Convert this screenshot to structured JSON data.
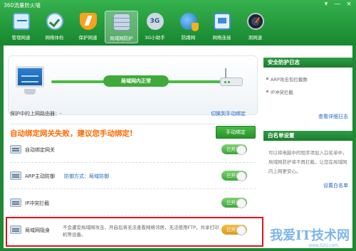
{
  "app": {
    "title": "360流量防火墙"
  },
  "window_controls": [
    "▾",
    "—",
    "×"
  ],
  "toolbar": [
    {
      "label": "管理网速",
      "icon": "speed-monitor-icon",
      "active": false
    },
    {
      "label": "网络体检",
      "icon": "health-check-icon",
      "active": false
    },
    {
      "label": "保护网速",
      "icon": "shield-speed-icon",
      "active": false
    },
    {
      "label": "局域网防护",
      "icon": "firewall-wall-icon",
      "active": true
    },
    {
      "label": "3G小助手",
      "icon": "3g-icon",
      "active": false
    },
    {
      "label": "防蹭网",
      "icon": "anti-leech-icon",
      "active": false
    },
    {
      "label": "网络连接",
      "icon": "network-connection-icon",
      "active": false
    },
    {
      "label": "测网速",
      "icon": "speedometer-icon",
      "active": false
    }
  ],
  "hero": {
    "status": "局域网内正常"
  },
  "gateway": {
    "label": "保护中的上网路由器：-",
    "switch_link": "切换到手动绑定"
  },
  "alert": {
    "text": "自动绑定网关失败，建议您手动绑定!",
    "button": "手动绑定"
  },
  "features": [
    {
      "name": "自动绑定网关",
      "sub": "",
      "desc": "",
      "toggle": "已开启"
    },
    {
      "name": "ARP主动防御",
      "sub": "防御方式：局域防御",
      "desc": "",
      "toggle": "已开启"
    },
    {
      "name": "IP冲突拦截",
      "sub": "",
      "desc": "",
      "toggle": "已开启"
    },
    {
      "name": "局域网隐身",
      "sub": "",
      "desc": "不会遭受局域网攻击，开启后将无法查看网络邻居，无法使用FTP，共享打印机等设备。",
      "toggle": "已开启"
    }
  ],
  "right": {
    "log_title": "安全防护日志",
    "log_items": [
      "ARP攻击包拦截数",
      "IP冲突拦截"
    ],
    "log_link": "查看详细日志",
    "whitelist_title": "白名单设置",
    "whitelist_text": "可以将电脑中的程序添加入白名单中，局域网防护将不再拦截，让您在局域网内上网更安心。",
    "whitelist_link": "设置白名单"
  },
  "watermark": {
    "text": "我爱IT技术网",
    "sub": "www.52ij.com"
  }
}
